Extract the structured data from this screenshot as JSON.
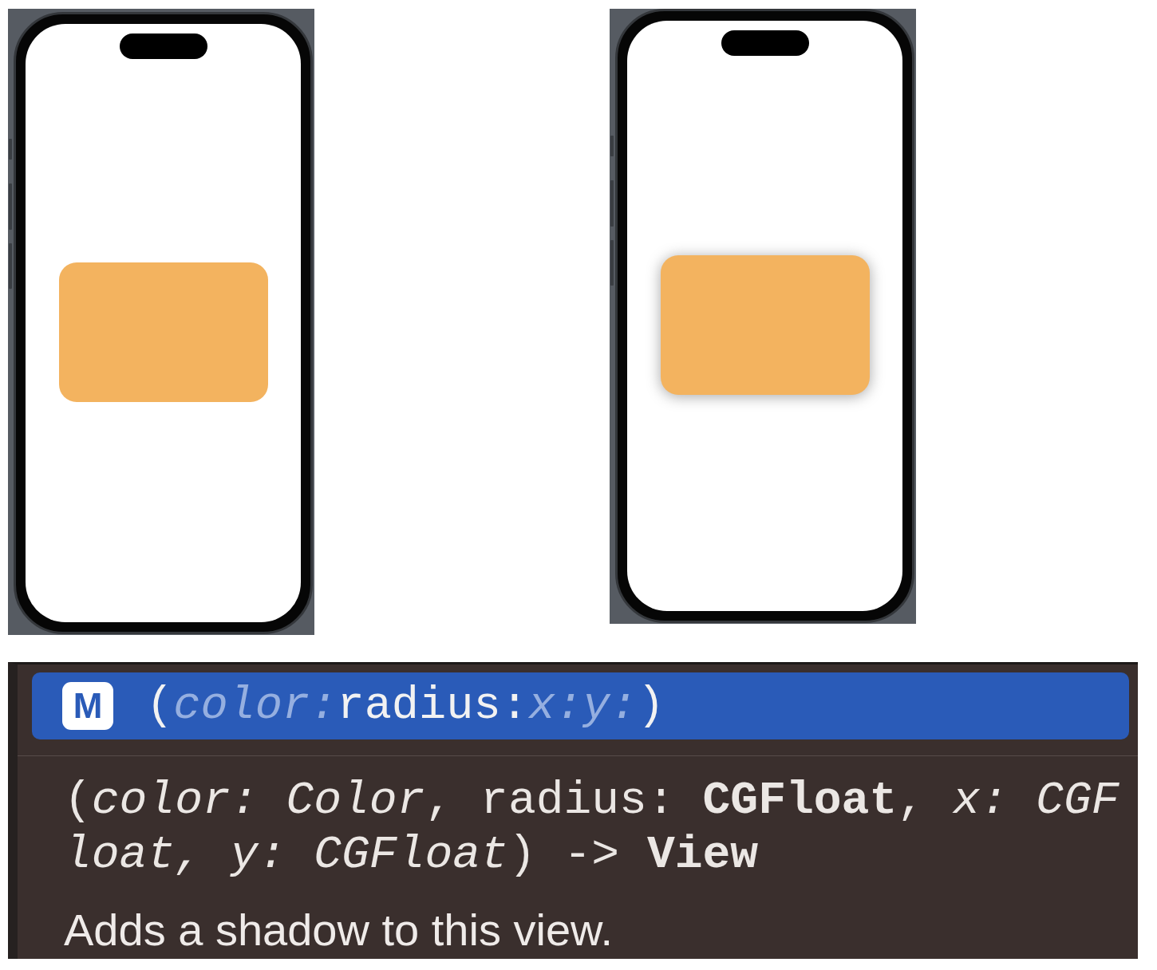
{
  "previews": [
    {
      "shadow": false
    },
    {
      "shadow": true
    }
  ],
  "completion": {
    "items": [
      {
        "badge": "M",
        "parts": [
          {
            "text": "(",
            "kind": "plain"
          },
          {
            "text": "color:",
            "kind": "param"
          },
          {
            "text": "radius:",
            "kind": "plain"
          },
          {
            "text": "x:y:",
            "kind": "param"
          },
          {
            "text": ")",
            "kind": "plain"
          }
        ],
        "selected": true
      }
    ],
    "signature": "(*color: Color*, radius: **CGFloat**, *x: CGFloat, y: CGFloat*) -> **View**",
    "description": "Adds a shadow to this view."
  }
}
